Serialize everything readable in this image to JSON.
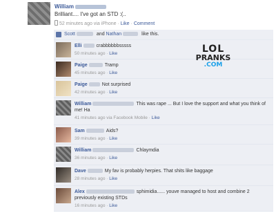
{
  "post": {
    "author": "William",
    "text": "Brilliant.... I've got an STD :(..",
    "time": "52 minutes ago via iPhone",
    "like_label": "Like",
    "comment_label": "Comment"
  },
  "likes": {
    "name1": "Scott",
    "and": "and",
    "name2": "Nathan",
    "suffix": "like this."
  },
  "watermark": {
    "line1": "LOL",
    "line2": "PRANKS",
    "line3": ".COM"
  },
  "comments": [
    {
      "name": "Elli",
      "text": "crabbbbbbsssss",
      "time": "50 minutes ago",
      "like": "Like"
    },
    {
      "name": "Paige",
      "text": "Tramp",
      "time": "45 minutes ago",
      "like": "Like"
    },
    {
      "name": "Paige",
      "text": "Not surprised",
      "time": "42 minutes ago",
      "like": "Like"
    },
    {
      "name": "William",
      "text": "This was rape ... But I love the support and what you think of me! Ha",
      "time": "41 minutes ago via Facebook Mobile",
      "like": "Like"
    },
    {
      "name": "Sam",
      "text": "Aids?",
      "time": "39 minutes ago",
      "like": "Like"
    },
    {
      "name": "William",
      "text": "Chlaymdia",
      "time": "36 minutes ago",
      "like": "Like"
    },
    {
      "name": "Dave",
      "text": "My fav is probably herpies. That shits like baggage",
      "time": "28 minutes ago",
      "like": "Like"
    },
    {
      "name": "Alex",
      "text": "sphimidia...... youve managed to host and combine 2 previously existing STDs",
      "time": "16 minutes ago",
      "like": "Like"
    }
  ]
}
